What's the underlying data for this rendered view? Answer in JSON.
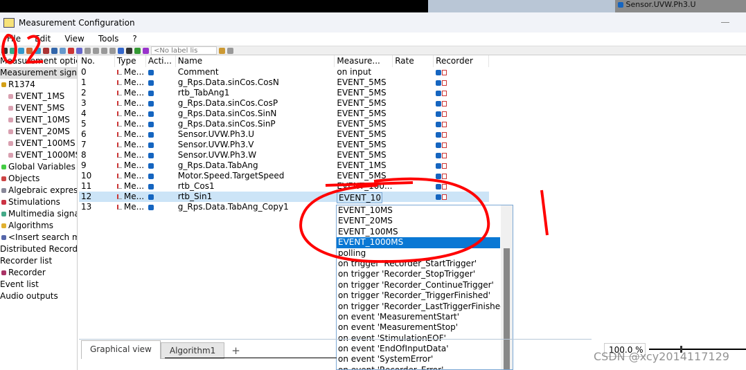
{
  "background": {
    "panel_text": "Sensor.UVW.Ph3.U"
  },
  "window": {
    "title": "Measurement Configuration"
  },
  "menu": [
    "File",
    "Edit",
    "View",
    "Tools",
    "?"
  ],
  "toolbar": {
    "label_list": "<No label lis"
  },
  "tree": [
    {
      "label": "Measurement optic",
      "level": 0,
      "icon": "none"
    },
    {
      "label": "Measurement signa",
      "level": 0,
      "icon": "none",
      "selected": true
    },
    {
      "label": "R1374",
      "level": 0,
      "icon": "device-icon"
    },
    {
      "label": "EVENT_1MS",
      "level": 1,
      "icon": "clock-icon"
    },
    {
      "label": "EVENT_5MS",
      "level": 1,
      "icon": "clock-icon"
    },
    {
      "label": "EVENT_10MS",
      "level": 1,
      "icon": "clock-icon"
    },
    {
      "label": "EVENT_20MS",
      "level": 1,
      "icon": "clock-icon"
    },
    {
      "label": "EVENT_100MS",
      "level": 1,
      "icon": "clock-icon"
    },
    {
      "label": "EVENT_1000MS",
      "level": 1,
      "icon": "clock-icon"
    },
    {
      "label": "Global Variables",
      "level": 0,
      "icon": "variable-icon"
    },
    {
      "label": "Objects",
      "level": 0,
      "icon": "objects-icon"
    },
    {
      "label": "Algebraic express",
      "level": 0,
      "icon": "expression-icon"
    },
    {
      "label": "Stimulations",
      "level": 0,
      "icon": "stimulation-icon"
    },
    {
      "label": "Multimedia signa",
      "level": 0,
      "icon": "multimedia-icon"
    },
    {
      "label": "Algorithms",
      "level": 0,
      "icon": "folder-icon"
    },
    {
      "label": "<Insert search ma",
      "level": 0,
      "icon": "search-icon"
    },
    {
      "label": "Distributed Recordi",
      "level": 0,
      "icon": "none"
    },
    {
      "label": "Recorder list",
      "level": 0,
      "icon": "none"
    },
    {
      "label": "Recorder",
      "level": 0,
      "icon": "recorder-icon"
    },
    {
      "label": "Event list",
      "level": 0,
      "icon": "none"
    },
    {
      "label": "Audio outputs",
      "level": 0,
      "icon": "none"
    }
  ],
  "table": {
    "columns": [
      "No.",
      "Type",
      "Acti...",
      "Name",
      "Measure...",
      "Rate",
      "Recorder"
    ],
    "rows": [
      {
        "no": "0",
        "type": "Me...",
        "name": "Comment",
        "measure": "on input"
      },
      {
        "no": "1",
        "type": "Me...",
        "name": "g_Rps.Data.sinCos.CosN",
        "measure": "EVENT_5MS"
      },
      {
        "no": "2",
        "type": "Me...",
        "name": "rtb_TabAng1",
        "measure": "EVENT_5MS"
      },
      {
        "no": "3",
        "type": "Me...",
        "name": "g_Rps.Data.sinCos.CosP",
        "measure": "EVENT_5MS"
      },
      {
        "no": "4",
        "type": "Me...",
        "name": "g_Rps.Data.sinCos.SinN",
        "measure": "EVENT_5MS"
      },
      {
        "no": "5",
        "type": "Me...",
        "name": "g_Rps.Data.sinCos.SinP",
        "measure": "EVENT_5MS"
      },
      {
        "no": "6",
        "type": "Me...",
        "name": "Sensor.UVW.Ph3.U",
        "measure": "EVENT_5MS"
      },
      {
        "no": "7",
        "type": "Me...",
        "name": "Sensor.UVW.Ph3.V",
        "measure": "EVENT_5MS"
      },
      {
        "no": "8",
        "type": "Me...",
        "name": "Sensor.UVW.Ph3.W",
        "measure": "EVENT_5MS"
      },
      {
        "no": "9",
        "type": "Me...",
        "name": "g_Rps.Data.TabAng",
        "measure": "EVENT_1MS"
      },
      {
        "no": "10",
        "type": "Me...",
        "name": "Motor.Speed.TargetSpeed",
        "measure": "EVENT_5MS"
      },
      {
        "no": "11",
        "type": "Me...",
        "name": "rtb_Cos1",
        "measure": "EVENT_100..."
      },
      {
        "no": "12",
        "type": "Me...",
        "name": "rtb_Sin1",
        "measure": "",
        "selected": true
      },
      {
        "no": "13",
        "type": "Me...",
        "name": "g_Rps.Data.TabAng_Copy1",
        "measure": ""
      }
    ]
  },
  "combo": {
    "value": "EVENT_10("
  },
  "dropdown": {
    "options": [
      "EVENT_10MS",
      "EVENT_20MS",
      "EVENT_100MS",
      "EVENT_1000MS",
      "polling",
      "on trigger 'Recorder_StartTrigger'",
      "on trigger 'Recorder_StopTrigger'",
      "on trigger 'Recorder_ContinueTrigger'",
      "on trigger 'Recorder_TriggerFinished'",
      "on trigger 'Recorder_LastTriggerFinished'",
      "on event 'MeasurementStart'",
      "on event 'MeasurementStop'",
      "on event 'StimulationEOF'",
      "on event 'EndOfInputData'",
      "on event 'SystemError'",
      "on event 'Recorder_Error'"
    ],
    "highlighted": "EVENT_1000MS"
  },
  "tabs": [
    "Graphical view",
    "Algorithm1"
  ],
  "tab_add": "+",
  "zoom": "100.0 %",
  "watermark": "CSDN @xcy2014117129",
  "colors": {
    "selection": "#cce4f7",
    "highlight": "#0a78d4",
    "annotation": "#ff0000"
  }
}
